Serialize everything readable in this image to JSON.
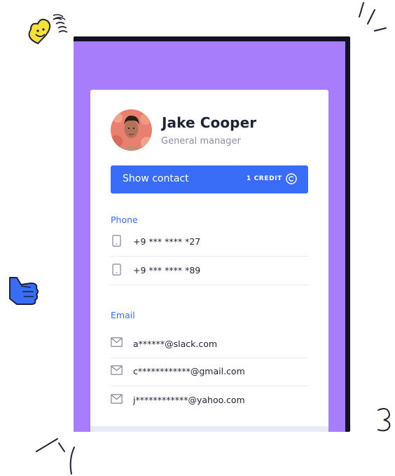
{
  "profile": {
    "name": "Jake Cooper",
    "role": "General manager"
  },
  "action": {
    "label": "Show contact",
    "credit": "1 CREDIT"
  },
  "phone": {
    "title": "Phone",
    "items": [
      "+9 *** **** *27",
      "+9 *** **** *89"
    ]
  },
  "email": {
    "title": "Email",
    "items": [
      "a******@slack.com",
      "c************@gmail.com",
      "j************@yahoo.com"
    ]
  },
  "colors": {
    "frame": "#a87dfc",
    "accent": "#3a6df7",
    "text": "#1f2235"
  },
  "icons": [
    "smiley-heart-icon",
    "thumbs-up-icon",
    "phone-icon",
    "mail-icon",
    "coin-icon"
  ]
}
